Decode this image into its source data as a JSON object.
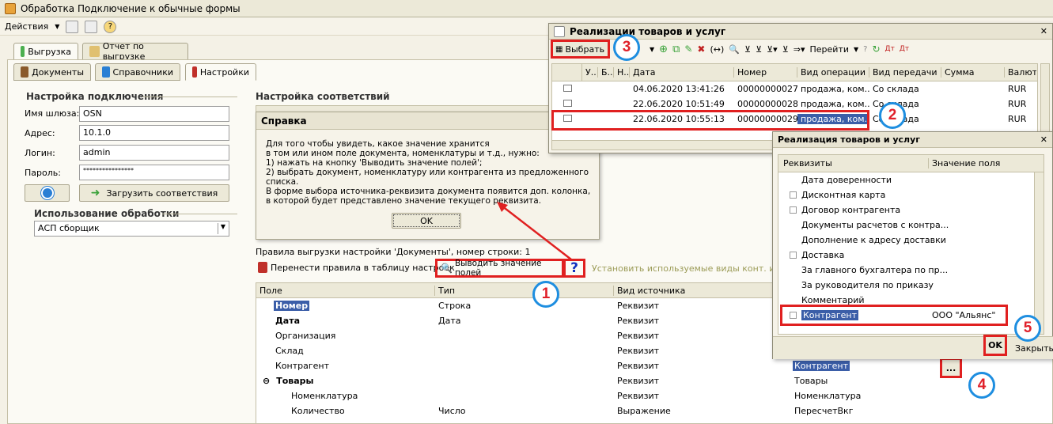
{
  "window": {
    "title": "Обработка  Подключение к обычные формы"
  },
  "toolbar": {
    "actions_label": "Действия"
  },
  "top_tabs": [
    {
      "label": "Выгрузка"
    },
    {
      "label": "Отчет по выгрузке"
    }
  ],
  "sub_tabs": [
    {
      "label": "Документы"
    },
    {
      "label": "Справочники"
    },
    {
      "label": "Настройки"
    }
  ],
  "connection": {
    "title": "Настройка подключения",
    "gateway_label": "Имя шлюза:",
    "gateway_value": "OSN",
    "address_label": "Адрес:",
    "address_value": "10.1.0",
    "login_label": "Логин:",
    "login_value": "admin",
    "password_label": "Пароль:",
    "password_value": "****************",
    "load_button": "Загрузить соответствия"
  },
  "usage": {
    "title": "Использование обработки",
    "select_value": "АСП сборщик"
  },
  "mapping": {
    "title": "Настройка соответствий"
  },
  "help": {
    "title": "Справка",
    "lines": [
      "Для того чтобы увидеть, какое значение хранится",
      "в том или ином поле документа, номенклатуры и т.д., нужно:",
      "1) нажать на кнопку 'Выводить значение полей';",
      "2) выбрать документ, номенклатуру или контрагента из предложенного списка.",
      "В форме выбора источника-реквизита документа появится доп. колонка,",
      "в которой будет представлено значение текущего реквизита."
    ],
    "ok": "OK"
  },
  "rules": {
    "caption": "Правила выгрузки настройки 'Документы', номер строки: 1",
    "move_button": "Перенести правила в таблицу настроек",
    "show_values_button": "Выводить значение полей",
    "set_types": "Установить используемые виды конт. инф.",
    "columns": [
      "Поле",
      "Тип",
      "Вид источника"
    ],
    "rows": [
      {
        "field": "Номер",
        "type": "Строка",
        "source": "Реквизит",
        "right": ""
      },
      {
        "field": "Дата",
        "type": "Дата",
        "source": "Реквизит",
        "right": ""
      },
      {
        "field": "Организация",
        "type": "",
        "source": "Реквизит",
        "right": ""
      },
      {
        "field": "Склад",
        "type": "",
        "source": "Реквизит",
        "right": ""
      },
      {
        "field": "Контрагент",
        "type": "",
        "source": "Реквизит",
        "right": "Контрагент"
      },
      {
        "field": "Товары",
        "type": "",
        "source": "Реквизит",
        "right": "Товары"
      },
      {
        "field": "Номенклатура",
        "type": "",
        "source": "Реквизит",
        "right": "Номенклатура"
      },
      {
        "field": "Количество",
        "type": "Число",
        "source": "Выражение",
        "right": "ПересчетВкг"
      }
    ],
    "ellipsis": "..."
  },
  "sales": {
    "title": "Реализации товаров и услуг",
    "choose_button": "Выбрать",
    "goto": "Перейти",
    "columns": [
      "У..",
      "Б..",
      "Н..",
      "Дата",
      "Номер",
      "Вид операции",
      "Вид передачи",
      "Сумма",
      "Валют"
    ],
    "rows": [
      {
        "date": "04.06.2020 13:41:26",
        "num": "00000000027",
        "op": "продажа, ком...",
        "transfer": "Со склада",
        "cur": "RUR"
      },
      {
        "date": "22.06.2020 10:51:49",
        "num": "00000000028",
        "op": "продажа, ком...",
        "transfer": "Со склада",
        "cur": "RUR"
      },
      {
        "date": "22.06.2020 10:55:13",
        "num": "00000000029",
        "op": "продажа, ком...",
        "transfer": "Со склада",
        "cur": "RUR"
      }
    ]
  },
  "requisites": {
    "title": "Реализация товаров и услуг",
    "col1": "Реквизиты",
    "col2": "Значение поля",
    "items": [
      {
        "label": "Дата доверенности",
        "plus": false,
        "value": ""
      },
      {
        "label": "Дисконтная карта",
        "plus": true,
        "value": ""
      },
      {
        "label": "Договор контрагента",
        "plus": true,
        "value": ""
      },
      {
        "label": "Документы расчетов с контра...",
        "plus": false,
        "value": ""
      },
      {
        "label": "Дополнение к адресу доставки",
        "plus": false,
        "value": ""
      },
      {
        "label": "Доставка",
        "plus": true,
        "value": ""
      },
      {
        "label": "За главного бухгалтера по пр...",
        "plus": false,
        "value": ""
      },
      {
        "label": "За руководителя по приказу",
        "plus": false,
        "value": ""
      },
      {
        "label": "Комментарий",
        "plus": false,
        "value": ""
      },
      {
        "label": "Контрагент",
        "plus": true,
        "value": "ООО \"Альянс\""
      }
    ],
    "ok": "OK",
    "close": "Закрыть"
  },
  "badges": [
    "1",
    "2",
    "3",
    "4",
    "5"
  ],
  "colors": {
    "highlight": "#e02020",
    "badge_ring": "#1e8ee0",
    "selection": "#3b5ea8"
  }
}
